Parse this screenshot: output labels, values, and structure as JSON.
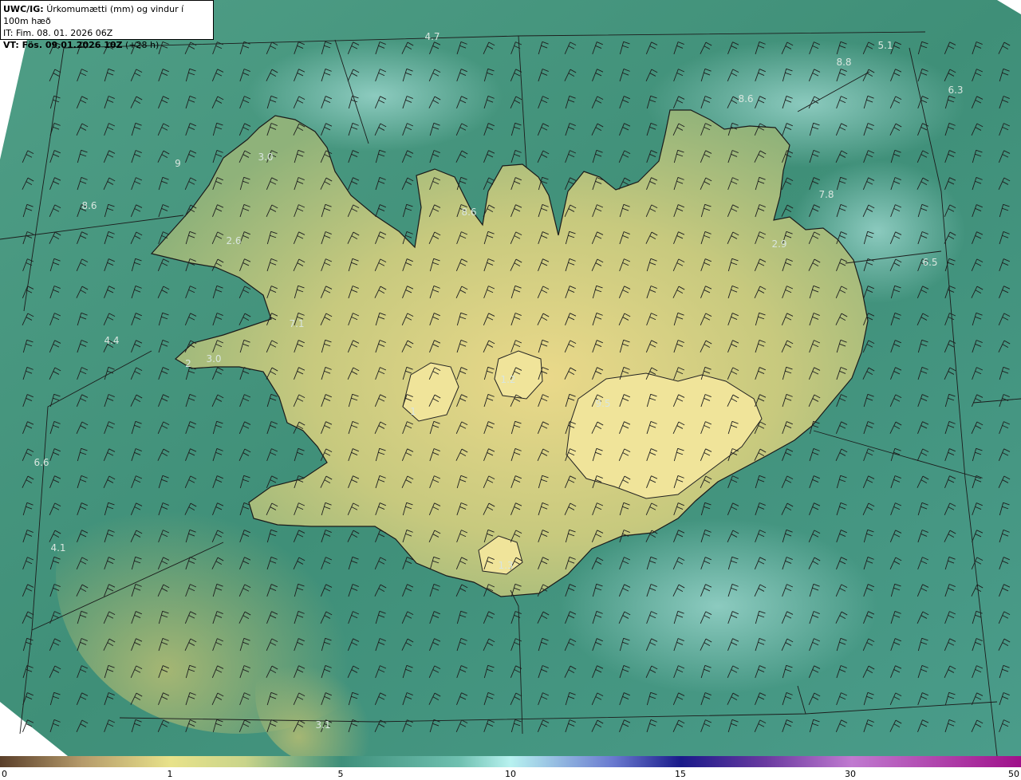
{
  "header": {
    "title_bold": "UWC/IG:",
    "title_rest": "Úrkomumætti (mm) og vindur í 100m hæð",
    "init_time": "IT: Fim. 08. 01. 2026 06Z",
    "valid_bold": "VT: Fös. 09.01.2026 10Z",
    "valid_rest": "(+28 h)"
  },
  "value_labels": [
    "4.7",
    "5.1",
    "8.8",
    "8.6",
    "6.3",
    "3.0",
    "9",
    "8.6",
    "2.6",
    "8.6",
    "7.8",
    "2.9",
    "6.5",
    "7.1",
    "4.4",
    "3.0",
    "2",
    "6.6",
    "4.1",
    "3.1",
    "1.3",
    "1",
    "1.2",
    "9.5"
  ],
  "colorbar": {
    "ticks": [
      "0",
      "1",
      "5",
      "10",
      "15",
      "30",
      "50"
    ],
    "colors": {
      "dry": "#5a3f2a",
      "low": "#e8e28a",
      "mid": "#3e8f7a",
      "light": "#b8f2f0",
      "deep": "#1a1a8a",
      "purple": "#c07ad0",
      "magenta": "#a0108a"
    }
  }
}
